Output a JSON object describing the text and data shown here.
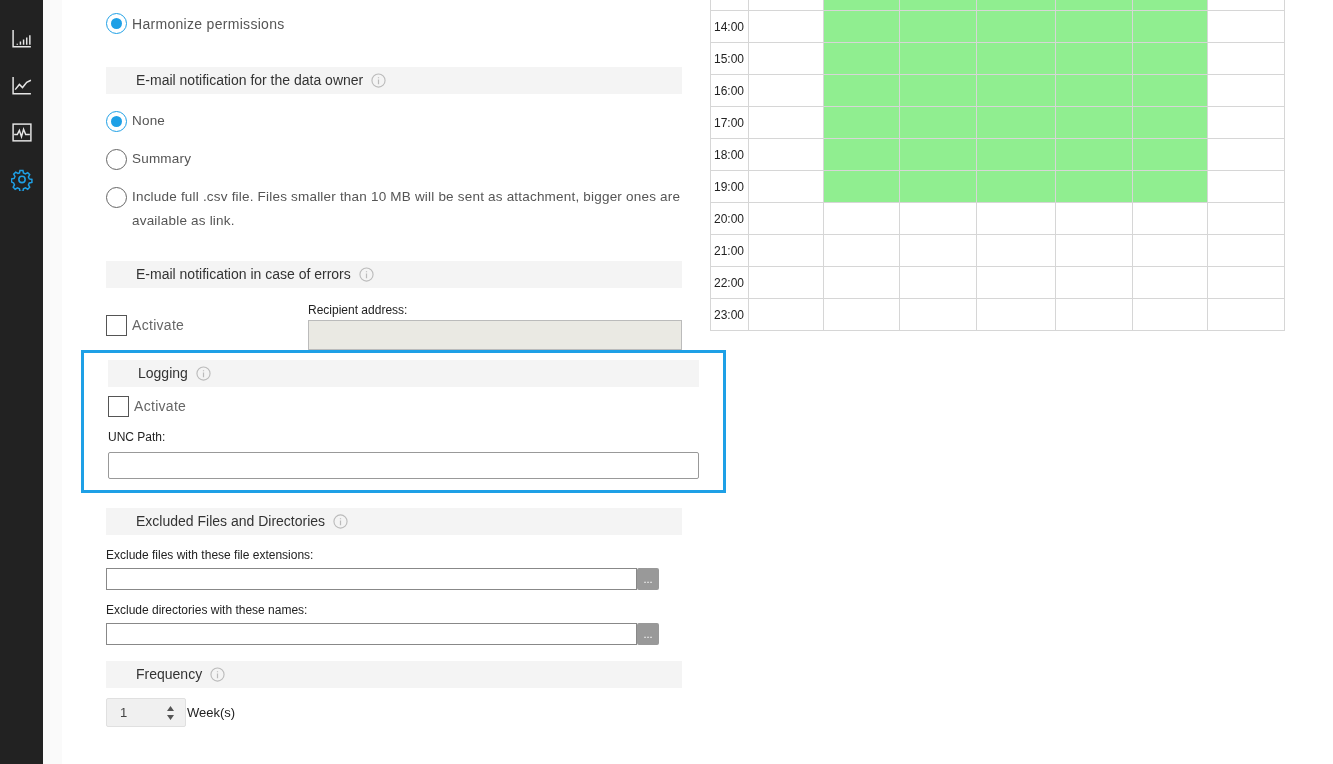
{
  "sidebar": {
    "items": [
      {
        "kind": "bars",
        "selected": false
      },
      {
        "kind": "line",
        "selected": false
      },
      {
        "kind": "pulse",
        "selected": false
      },
      {
        "kind": "gear",
        "selected": true
      }
    ]
  },
  "permissions": {
    "options": [
      {
        "label": "Harmonize permissions",
        "selected": true
      }
    ]
  },
  "owner_notification": {
    "title": "E-mail notification for the data owner",
    "options": [
      {
        "label": "None",
        "selected": true
      },
      {
        "label": "Summary",
        "selected": false
      },
      {
        "label": "Include full .csv file. Files smaller than 10 MB will be sent as attachment, bigger ones are available as link.",
        "selected": false
      }
    ]
  },
  "error_notification": {
    "title": "E-mail notification in case of errors",
    "activate": {
      "label": "Activate",
      "checked": false
    },
    "recipient": {
      "label": "Recipient address:",
      "disabled": true
    }
  },
  "logging": {
    "title": "Logging",
    "highlighted": true,
    "activate": {
      "label": "Activate",
      "checked": false
    },
    "path_label": "UNC Path:"
  },
  "exclusions": {
    "title": "Excluded Files and Directories",
    "fields": [
      {
        "label": "Exclude files with these file extensions:",
        "button": "..."
      },
      {
        "label": "Exclude directories with these names:",
        "button": "..."
      }
    ]
  },
  "frequency": {
    "title": "Frequency",
    "value": "1",
    "unit": "Week(s)"
  },
  "schedule": {
    "rows": [
      {
        "cells": [
          {
            "on": false
          },
          {
            "on": true
          },
          {
            "on": true
          },
          {
            "on": true
          },
          {
            "on": true
          },
          {
            "on": true
          },
          {
            "on": false
          }
        ]
      },
      {
        "time": "14:00",
        "cells": [
          {
            "on": false
          },
          {
            "on": true
          },
          {
            "on": true
          },
          {
            "on": true
          },
          {
            "on": true
          },
          {
            "on": true
          },
          {
            "on": false
          }
        ]
      },
      {
        "time": "15:00",
        "cells": [
          {
            "on": false
          },
          {
            "on": true
          },
          {
            "on": true
          },
          {
            "on": true
          },
          {
            "on": true
          },
          {
            "on": true
          },
          {
            "on": false
          }
        ]
      },
      {
        "time": "16:00",
        "cells": [
          {
            "on": false
          },
          {
            "on": true
          },
          {
            "on": true
          },
          {
            "on": true
          },
          {
            "on": true
          },
          {
            "on": true
          },
          {
            "on": false
          }
        ]
      },
      {
        "time": "17:00",
        "cells": [
          {
            "on": false
          },
          {
            "on": true
          },
          {
            "on": true
          },
          {
            "on": true
          },
          {
            "on": true
          },
          {
            "on": true
          },
          {
            "on": false
          }
        ]
      },
      {
        "time": "18:00",
        "cells": [
          {
            "on": false
          },
          {
            "on": true
          },
          {
            "on": true
          },
          {
            "on": true
          },
          {
            "on": true
          },
          {
            "on": true
          },
          {
            "on": false
          }
        ]
      },
      {
        "time": "19:00",
        "cells": [
          {
            "on": false
          },
          {
            "on": true
          },
          {
            "on": true
          },
          {
            "on": true
          },
          {
            "on": true
          },
          {
            "on": true
          },
          {
            "on": false
          }
        ]
      },
      {
        "time": "20:00",
        "cells": [
          {
            "on": false
          },
          {
            "on": false
          },
          {
            "on": false
          },
          {
            "on": false
          },
          {
            "on": false
          },
          {
            "on": false
          },
          {
            "on": false
          }
        ]
      },
      {
        "time": "21:00",
        "cells": [
          {
            "on": false
          },
          {
            "on": false
          },
          {
            "on": false
          },
          {
            "on": false
          },
          {
            "on": false
          },
          {
            "on": false
          },
          {
            "on": false
          }
        ]
      },
      {
        "time": "22:00",
        "cells": [
          {
            "on": false
          },
          {
            "on": false
          },
          {
            "on": false
          },
          {
            "on": false
          },
          {
            "on": false
          },
          {
            "on": false
          },
          {
            "on": false
          }
        ]
      },
      {
        "time": "23:00",
        "cells": [
          {
            "on": false
          },
          {
            "on": false
          },
          {
            "on": false
          },
          {
            "on": false
          },
          {
            "on": false
          },
          {
            "on": false
          },
          {
            "on": false
          }
        ]
      }
    ]
  }
}
